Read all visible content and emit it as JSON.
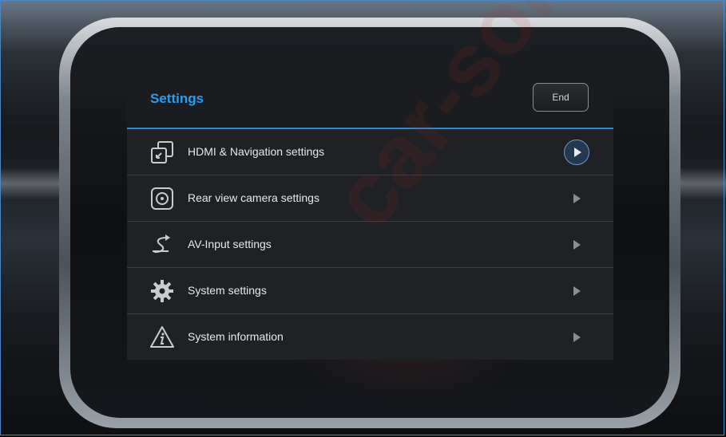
{
  "screen": {
    "title": "Settings",
    "end_button_label": "End"
  },
  "menu": {
    "items": [
      {
        "label": "HDMI & Navigation settings",
        "icon": "hdmi-window-icon",
        "active": true
      },
      {
        "label": "Rear view camera settings",
        "icon": "camera-icon",
        "active": false
      },
      {
        "label": "AV-Input settings",
        "icon": "av-input-icon",
        "active": false
      },
      {
        "label": "System settings",
        "icon": "gear-icon",
        "active": false
      },
      {
        "label": "System information",
        "icon": "info-warning-icon",
        "active": false
      }
    ]
  },
  "watermark": {
    "text": "car-sol"
  },
  "colors": {
    "accent": "#2d9bf0",
    "screen_background": "#1f2124",
    "text": "#e6e8ea"
  }
}
